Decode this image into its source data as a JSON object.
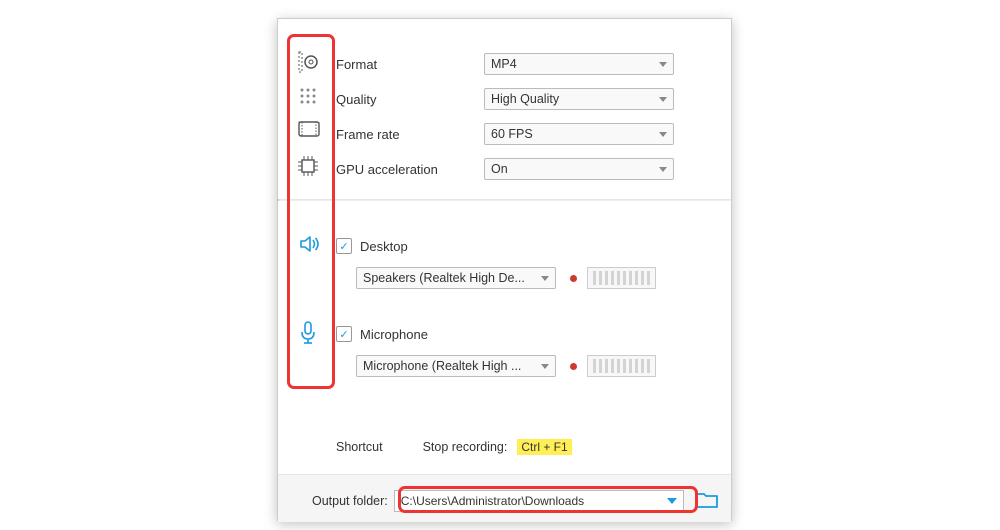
{
  "video": {
    "format_label": "Format",
    "format_value": "MP4",
    "quality_label": "Quality",
    "quality_value": "High Quality",
    "framerate_label": "Frame rate",
    "framerate_value": "60 FPS",
    "gpu_label": "GPU acceleration",
    "gpu_value": "On"
  },
  "audio": {
    "desktop_label": "Desktop",
    "desktop_checked": true,
    "desktop_device": "Speakers (Realtek High De...",
    "mic_label": "Microphone",
    "mic_checked": true,
    "mic_device": "Microphone (Realtek High ..."
  },
  "shortcut": {
    "section_label": "Shortcut",
    "stop_label": "Stop recording:",
    "stop_key": "Ctrl + F1"
  },
  "output": {
    "label": "Output folder:",
    "path": "C:\\Users\\Administrator\\Downloads"
  }
}
